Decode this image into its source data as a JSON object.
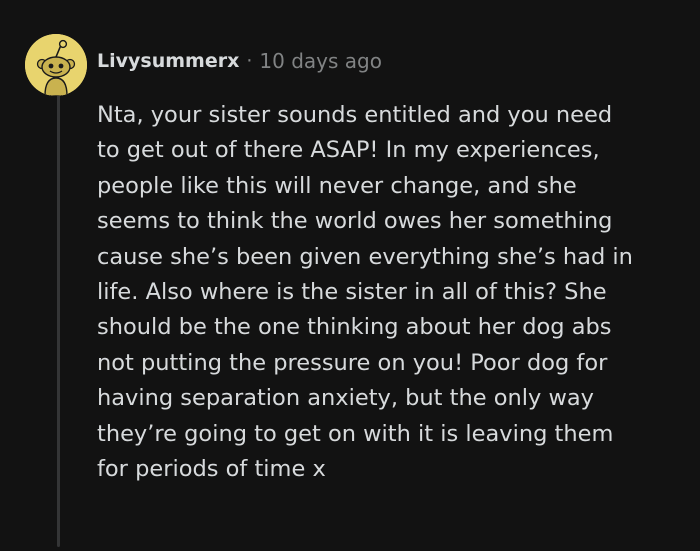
{
  "comment": {
    "author": "Livysummerx",
    "separator": "·",
    "timestamp": "10 days ago",
    "avatar_icon": "snoo-avatar-icon",
    "avatar_color": "#e8d46e",
    "body_lines": [
      "Nta, your sister sounds entitled and you need",
      "to get out of there ASAP! In my experiences,",
      "people like this will never change, and she",
      "seems to think the world owes her something",
      "cause she’s been given everything she’s had in",
      "life. Also where is the sister in all of this? She",
      "should be the one thinking about her dog abs",
      "not putting the pressure on you! Poor dog for",
      "having separation anxiety, but the only way",
      "they’re going to get on with it is leaving them",
      "for periods of time x"
    ]
  }
}
